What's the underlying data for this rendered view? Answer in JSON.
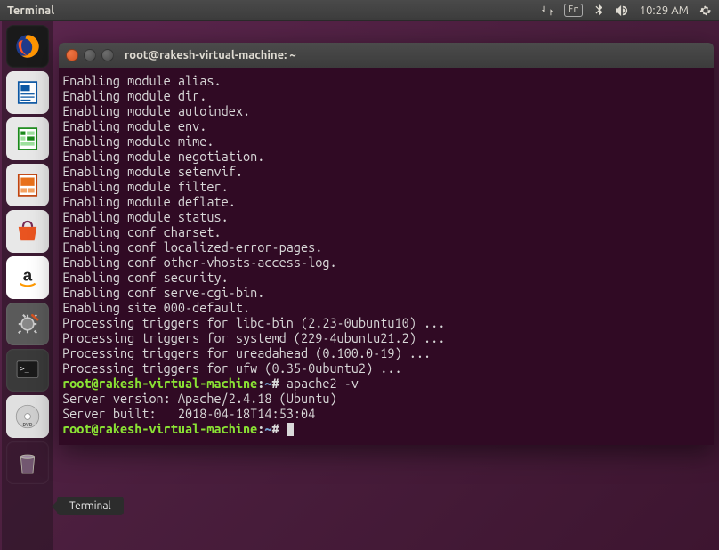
{
  "top_panel": {
    "app_name": "Terminal",
    "lang": "En",
    "time": "10:29 AM"
  },
  "tooltip": {
    "label": "Terminal"
  },
  "terminal": {
    "title": "root@rakesh-virtual-machine: ~",
    "lines": [
      "Enabling module alias.",
      "Enabling module dir.",
      "Enabling module autoindex.",
      "Enabling module env.",
      "Enabling module mime.",
      "Enabling module negotiation.",
      "Enabling module setenvif.",
      "Enabling module filter.",
      "Enabling module deflate.",
      "Enabling module status.",
      "Enabling conf charset.",
      "Enabling conf localized-error-pages.",
      "Enabling conf other-vhosts-access-log.",
      "Enabling conf security.",
      "Enabling conf serve-cgi-bin.",
      "Enabling site 000-default.",
      "Processing triggers for libc-bin (2.23-0ubuntu10) ...",
      "Processing triggers for systemd (229-4ubuntu21.2) ...",
      "Processing triggers for ureadahead (0.100.0-19) ...",
      "Processing triggers for ufw (0.35-0ubuntu2) ..."
    ],
    "prompt1_user": "root@rakesh-virtual-machine",
    "prompt1_path": "~",
    "prompt1_cmd": " apache2 -v",
    "server_version": "Server version: Apache/2.4.18 (Ubuntu)",
    "server_built": "Server built:   2018-04-18T14:53:04",
    "prompt2_user": "root@rakesh-virtual-machine",
    "prompt2_path": "~"
  },
  "launcher": {
    "items": [
      {
        "name": "firefox"
      },
      {
        "name": "writer"
      },
      {
        "name": "calc"
      },
      {
        "name": "impress"
      },
      {
        "name": "software"
      },
      {
        "name": "amazon"
      },
      {
        "name": "settings"
      },
      {
        "name": "terminal"
      },
      {
        "name": "dvd"
      },
      {
        "name": "trash"
      }
    ]
  }
}
